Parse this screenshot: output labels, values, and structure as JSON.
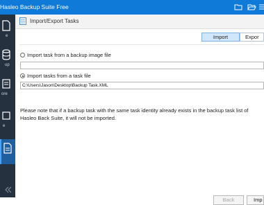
{
  "titlebar": {
    "title": "Hasleo Backup Suite Free"
  },
  "sidebar": {
    "items": [
      {
        "name": "sidebar-item-home",
        "icon": "home-icon",
        "label": "e"
      },
      {
        "name": "sidebar-item-backup",
        "icon": "database-icon",
        "label": "up"
      },
      {
        "name": "sidebar-item-restore",
        "icon": "restore-icon",
        "label": "ore"
      },
      {
        "name": "sidebar-item-tools",
        "icon": "tools-icon",
        "label": "e"
      },
      {
        "name": "sidebar-item-active",
        "icon": "document-icon",
        "label": ""
      }
    ]
  },
  "header": {
    "title": "Import/Export Tasks"
  },
  "tabs": [
    {
      "label": "Import",
      "active": true
    },
    {
      "label": "Expor",
      "active": false
    }
  ],
  "options": {
    "from_image": {
      "label": "Import task from a backup image file",
      "value": ""
    },
    "from_file": {
      "label": "Import tasks from a task file",
      "value": "C:\\Users\\Jason\\Desktop\\Backup Task.XML"
    }
  },
  "note": "Please note that if a backup task with the same task identity already exists in the backup task list of Hasleo Back Suite, it will not be imported.",
  "buttons": {
    "back": "Back",
    "import": "Imp"
  },
  "colors": {
    "titlebar": "#0f7ad8",
    "sidebar": "#263140",
    "accent": "#4aa3ff"
  }
}
